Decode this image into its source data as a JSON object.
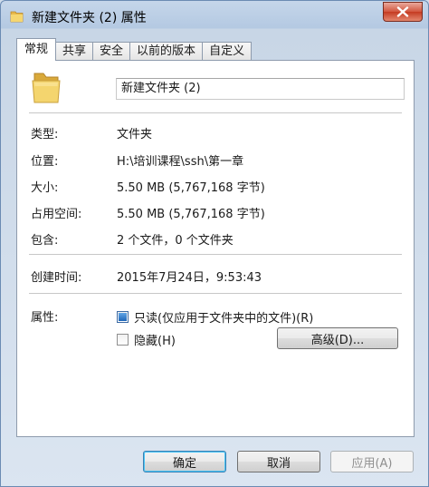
{
  "window": {
    "title": "新建文件夹 (2) 属性",
    "close_label": "×"
  },
  "tabs": [
    {
      "label": "常规",
      "active": true
    },
    {
      "label": "共享",
      "active": false
    },
    {
      "label": "安全",
      "active": false
    },
    {
      "label": "以前的版本",
      "active": false
    },
    {
      "label": "自定义",
      "active": false
    }
  ],
  "general": {
    "folder_name": "新建文件夹 (2)",
    "rows": [
      {
        "label": "类型:",
        "value": "文件夹"
      },
      {
        "label": "位置:",
        "value": "H:\\培训课程\\ssh\\第一章"
      },
      {
        "label": "大小:",
        "value": "5.50 MB (5,767,168 字节)"
      },
      {
        "label": "占用空间:",
        "value": "5.50 MB (5,767,168 字节)"
      },
      {
        "label": "包含:",
        "value": "2 个文件，0 个文件夹"
      }
    ],
    "created_label": "创建时间:",
    "created_value": "2015年7月24日，9:53:43",
    "attributes_label": "属性:",
    "readonly_label": "只读(仅应用于文件夹中的文件)(R)",
    "readonly_checked": true,
    "hidden_label": "隐藏(H)",
    "hidden_checked": false,
    "advanced_label": "高级(D)..."
  },
  "buttons": {
    "ok": "确定",
    "cancel": "取消",
    "apply": "应用(A)"
  },
  "colors": {
    "accent": "#3c7fb1",
    "close": "#c53b22",
    "folder": "#f2cf5b"
  }
}
